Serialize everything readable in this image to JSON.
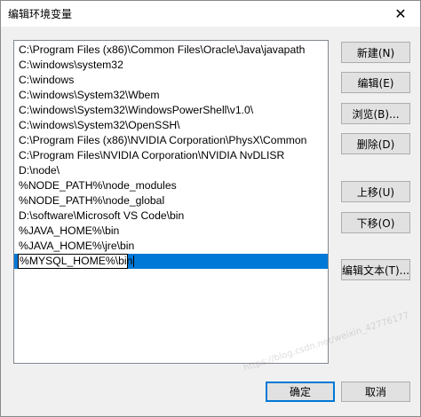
{
  "window": {
    "title": "编辑环境变量",
    "close_glyph": "✕"
  },
  "entries": [
    "C:\\Program Files (x86)\\Common Files\\Oracle\\Java\\javapath",
    "C:\\windows\\system32",
    "C:\\windows",
    "C:\\windows\\System32\\Wbem",
    "C:\\windows\\System32\\WindowsPowerShell\\v1.0\\",
    "C:\\windows\\System32\\OpenSSH\\",
    "C:\\Program Files (x86)\\NVIDIA Corporation\\PhysX\\Common",
    "C:\\Program Files\\NVIDIA Corporation\\NVIDIA NvDLISR",
    "D:\\node\\",
    "%NODE_PATH%\\node_modules",
    "%NODE_PATH%\\node_global",
    "D:\\software\\Microsoft VS Code\\bin",
    "%JAVA_HOME%\\bin",
    "%JAVA_HOME%\\jre\\bin"
  ],
  "editing_entry": "%MYSQL_HOME%\\bin",
  "buttons": {
    "new": "新建(N)",
    "edit": "编辑(E)",
    "browse": "浏览(B)...",
    "delete": "删除(D)",
    "move_up": "上移(U)",
    "move_down": "下移(O)",
    "edit_text": "编辑文本(T)...",
    "ok": "确定",
    "cancel": "取消"
  },
  "watermark": "https://blog.csdn.net/weixin_42776177"
}
